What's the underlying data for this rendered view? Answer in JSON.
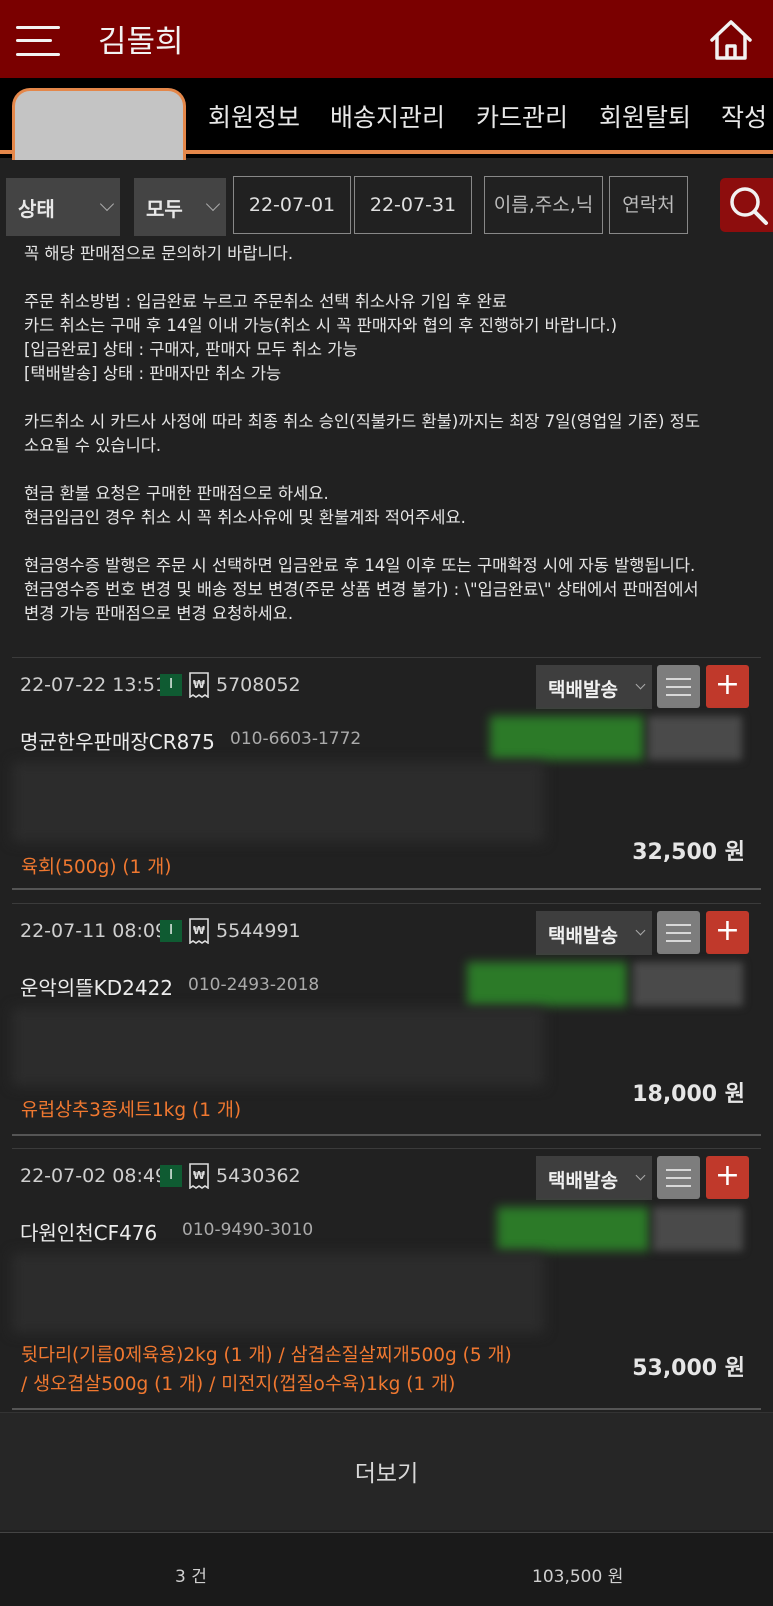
{
  "header": {
    "title": "김돌희"
  },
  "tabs": [
    "회원정보",
    "배송지관리",
    "카드관리",
    "회원탈퇴",
    "작성"
  ],
  "filter": {
    "status_select": "상태",
    "type_select": "모두",
    "date_from": "22-07-01",
    "date_to": "22-07-31",
    "name_placeholder": "이름,주소,닉",
    "contact_placeholder": "연락처"
  },
  "notice": {
    "line1": "꼭 해당 판매점으로 문의하기 바랍니다.",
    "line2": "주문 취소방법 : 입금완료 누르고 주문취소 선택 취소사유 기입 후 완료",
    "line3": "카드 취소는 구매 후 14일 이내 가능(취소 시 꼭 판매자와 협의 후 진행하기 바랍니다.)",
    "line4": "[입금완료] 상태 : 구매자, 판매자 모두 취소 가능",
    "line5": "[택배발송] 상태 : 판매자만 취소 가능",
    "line6": "카드취소 시 카드사 사정에 따라 최종 취소 승인(직불카드 환불)까지는 최장 7일(영업일 기준) 정도",
    "line7": "소요될 수 있습니다.",
    "line8": "현금 환불 요청은 구매한 판매점으로 하세요.",
    "line9": "현금입금인 경우 취소 시 꼭 취소사유에 및 환불계좌 적어주세요.",
    "line10": "현금영수증 발행은 주문 시 선택하면 입금완료 후 14일 이후 또는 구매확정 시에 자동 발행됩니다.",
    "line11": "현금영수증 번호 변경 및 배송 정보 변경(주문 상품 변경 불가) : \\\"입금완료\\\" 상태에서 판매점에서",
    "line12": "변경 가능 판매점으로 변경 요청하세요."
  },
  "orders": [
    {
      "datetime": "22-07-22 13:51",
      "badge": "I",
      "order_no": "5708052",
      "status": "택배발송",
      "shop": "명균한우판매장CR875",
      "phone": "010-6603-1772",
      "items_line1": "육회(500g) (1 개)",
      "items_line2": "",
      "total": "32,500 원"
    },
    {
      "datetime": "22-07-11 08:09",
      "badge": "I",
      "order_no": "5544991",
      "status": "택배발송",
      "shop": "운악의뜰KD2422",
      "phone": "010-2493-2018",
      "items_line1": "유럽상추3종세트1kg (1 개)",
      "items_line2": "",
      "total": "18,000 원"
    },
    {
      "datetime": "22-07-02 08:49",
      "badge": "I",
      "order_no": "5430362",
      "status": "택배발송",
      "shop": "다원인천CF476",
      "phone": "010-9490-3010",
      "items_line1": "뒷다리(기름0제육용)2kg (1 개) / 삼겹손질살찌개500g (5 개)",
      "items_line2": "/ 생오겹살500g (1 개) / 미전지(껍질o수육)1kg (1 개)",
      "total": "53,000 원"
    }
  ],
  "more_label": "더보기",
  "footer": {
    "count": "3 건",
    "sum": "103,500 원"
  },
  "colors": {
    "header_bg": "#7a0000",
    "accent": "#e4874a",
    "item_text": "#f07830",
    "plus_button": "#c0392b",
    "search_button": "#8d0d0d"
  }
}
